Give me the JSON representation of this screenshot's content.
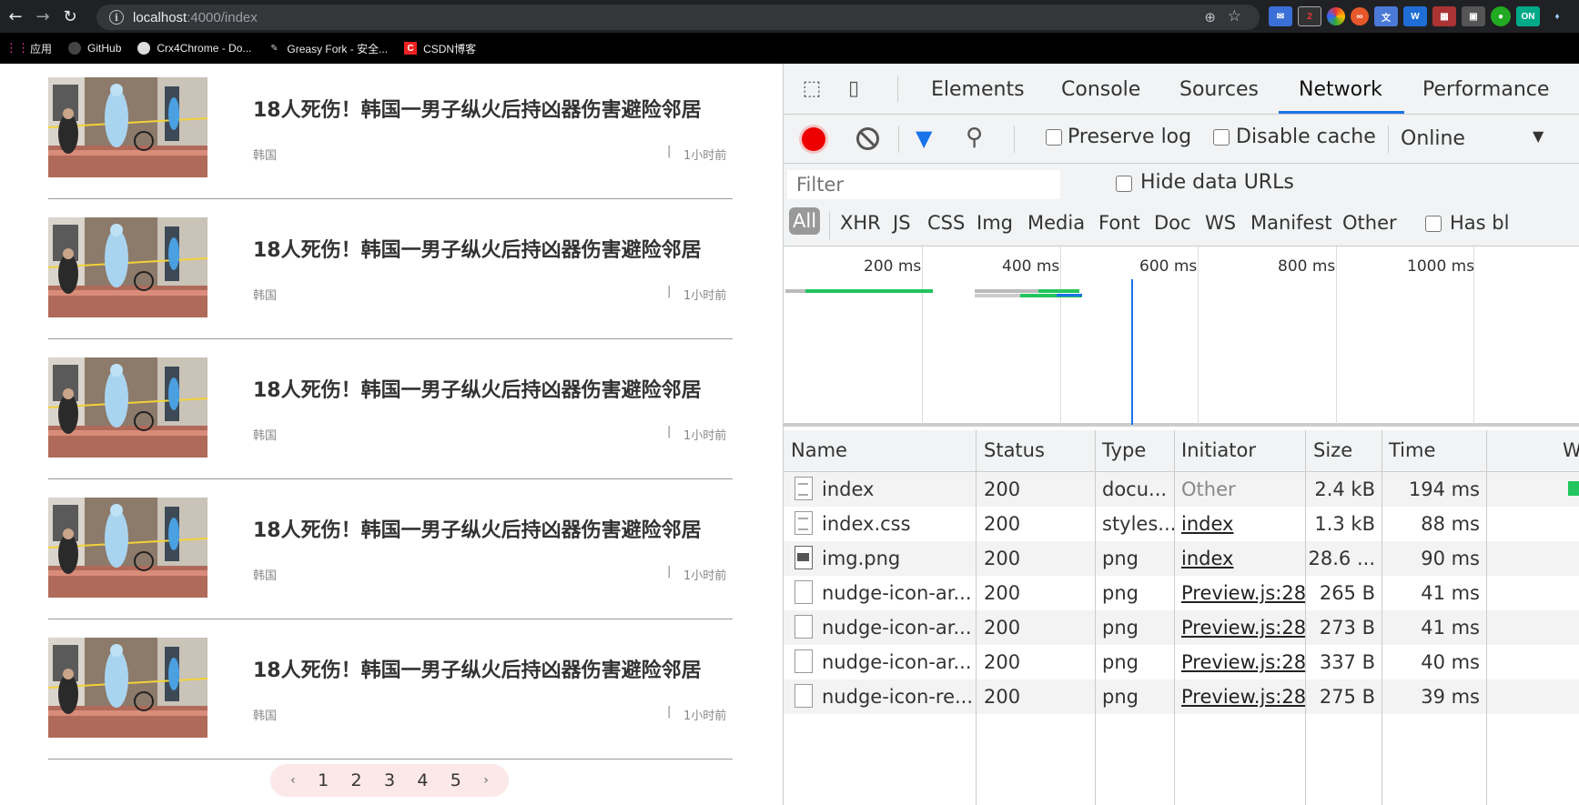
{
  "browser": {
    "url_host": "localhost",
    "url_path": ":4000/index",
    "bookmarks": [
      {
        "label": "应用",
        "icon": "apps-grid-icon"
      },
      {
        "label": "GitHub",
        "icon": "github-icon"
      },
      {
        "label": "Crx4Chrome - Do...",
        "icon": "crx-icon"
      },
      {
        "label": "Greasy Fork - 安全...",
        "icon": "greasyfork-icon"
      },
      {
        "label": "CSDN博客",
        "icon": "csdn-icon"
      }
    ],
    "extensions": [
      "2",
      "",
      "",
      "",
      "",
      "W",
      "",
      "",
      "",
      "ON",
      ""
    ]
  },
  "news": {
    "items": [
      {
        "title": "18人死伤！韩国一男子纵火后持凶器伤害避险邻居",
        "tag": "韩国",
        "separator": "|",
        "time": "1小时前"
      },
      {
        "title": "18人死伤！韩国一男子纵火后持凶器伤害避险邻居",
        "tag": "韩国",
        "separator": "|",
        "time": "1小时前"
      },
      {
        "title": "18人死伤！韩国一男子纵火后持凶器伤害避险邻居",
        "tag": "韩国",
        "separator": "|",
        "time": "1小时前"
      },
      {
        "title": "18人死伤！韩国一男子纵火后持凶器伤害避险邻居",
        "tag": "韩国",
        "separator": "|",
        "time": "1小时前"
      },
      {
        "title": "18人死伤！韩国一男子纵火后持凶器伤害避险邻居",
        "tag": "韩国",
        "separator": "|",
        "time": "1小时前"
      }
    ],
    "pagination": {
      "prev": "‹",
      "pages": [
        "1",
        "2",
        "3",
        "4",
        "5"
      ],
      "next": "›"
    }
  },
  "devtools": {
    "tabs": [
      "Elements",
      "Console",
      "Sources",
      "Network",
      "Performance"
    ],
    "active_tab": "Network",
    "toolbar": {
      "preserve_log": "Preserve log",
      "disable_cache": "Disable cache",
      "throttle": "Online"
    },
    "filter_placeholder": "Filter",
    "hide_data_urls": "Hide data URLs",
    "types": [
      "All",
      "XHR",
      "JS",
      "CSS",
      "Img",
      "Media",
      "Font",
      "Doc",
      "WS",
      "Manifest",
      "Other",
      "Has bl"
    ],
    "timeline_labels": [
      "200 ms",
      "400 ms",
      "600 ms",
      "800 ms",
      "1000 ms"
    ],
    "columns": [
      "Name",
      "Status",
      "Type",
      "Initiator",
      "Size",
      "Time",
      "W"
    ],
    "rows": [
      {
        "name": "index",
        "status": "200",
        "type": "docu...",
        "initiator": "Other",
        "size": "2.4 kB",
        "time": "194 ms",
        "icon": "doc"
      },
      {
        "name": "index.css",
        "status": "200",
        "type": "styles...",
        "initiator": "index",
        "size": "1.3 kB",
        "time": "88 ms",
        "icon": "doc"
      },
      {
        "name": "img.png",
        "status": "200",
        "type": "png",
        "initiator": "index",
        "size": "28.6 ...",
        "time": "90 ms",
        "icon": "img"
      },
      {
        "name": "nudge-icon-ar...",
        "status": "200",
        "type": "png",
        "initiator": "Preview.js:28",
        "size": "265 B",
        "time": "41 ms",
        "icon": "blank"
      },
      {
        "name": "nudge-icon-ar...",
        "status": "200",
        "type": "png",
        "initiator": "Preview.js:28",
        "size": "273 B",
        "time": "41 ms",
        "icon": "blank"
      },
      {
        "name": "nudge-icon-ar...",
        "status": "200",
        "type": "png",
        "initiator": "Preview.js:28",
        "size": "337 B",
        "time": "40 ms",
        "icon": "blank"
      },
      {
        "name": "nudge-icon-re...",
        "status": "200",
        "type": "png",
        "initiator": "Preview.js:28",
        "size": "275 B",
        "time": "39 ms",
        "icon": "blank"
      }
    ]
  },
  "colors": {
    "accent": "#1a73e8",
    "record": "#ee0000",
    "pagination_bg": "#fce8e8",
    "waterfall_green": "#22c55e"
  }
}
